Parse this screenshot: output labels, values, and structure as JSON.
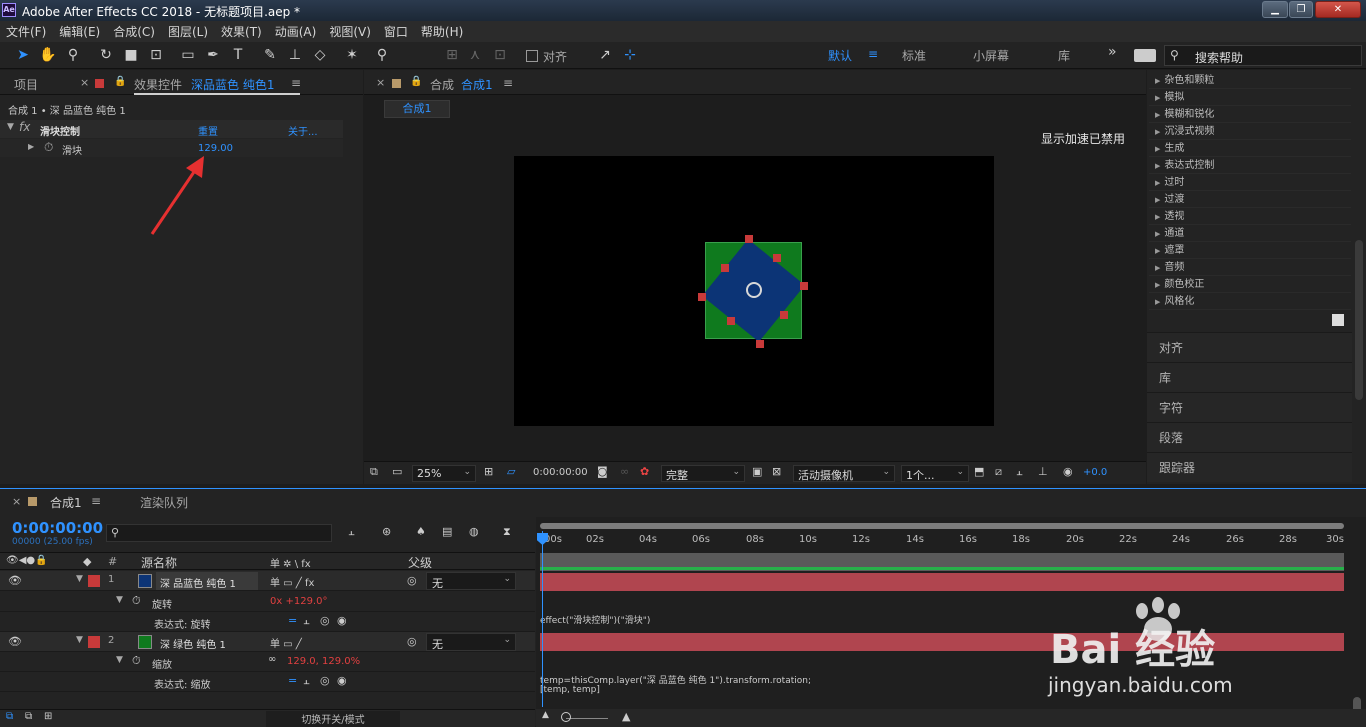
{
  "window": {
    "title": "Adobe After Effects CC 2018 - 无标题项目.aep *",
    "logo": "Ae"
  },
  "menu": [
    "文件(F)",
    "编辑(E)",
    "合成(C)",
    "图层(L)",
    "效果(T)",
    "动画(A)",
    "视图(V)",
    "窗口",
    "帮助(H)"
  ],
  "toolbar": {
    "snap_label": "对齐",
    "workspaces": [
      "默认",
      "标准",
      "小屏幕",
      "库"
    ],
    "more": "»",
    "search_placeholder": "搜索帮助"
  },
  "left_panel": {
    "tab_project": "项目",
    "tab_effects": "效果控件",
    "effects_layer": "深品蓝色 纯色1",
    "breadcrumb": "合成 1 • 深 品蓝色 纯色 1",
    "effect_name": "滑块控制",
    "reset": "重置",
    "about": "关于...",
    "param_name": "滑块",
    "param_value": "129.00"
  },
  "viewer": {
    "tab_prefix": "合成",
    "tab_name": "合成1",
    "subtab": "合成1",
    "accel_notice": "显示加速已禁用",
    "zoom": "25%",
    "timecode": "0:00:00:00",
    "quality": "完整",
    "camera": "活动摄像机",
    "views": "1个...",
    "exposure": "+0.0"
  },
  "effects_list": [
    "杂色和颗粒",
    "模拟",
    "模糊和锐化",
    "沉浸式视频",
    "生成",
    "表达式控制",
    "过时",
    "过渡",
    "透视",
    "通道",
    "遮罩",
    "音频",
    "颜色校正",
    "风格化"
  ],
  "side_sections": [
    "对齐",
    "库",
    "字符",
    "段落",
    "跟踪器"
  ],
  "timeline": {
    "tab_comp": "合成1",
    "tab_render": "渲染队列",
    "timecode": "0:00:00:00",
    "frame_info": "00000 (25.00 fps)",
    "col_num": "#",
    "col_source": "源名称",
    "col_switches": "单 ✲ \\ fx",
    "col_parent": "父级",
    "toggle_label": "切换开关/模式",
    "ruler": [
      "00s",
      "02s",
      "04s",
      "06s",
      "08s",
      "10s",
      "12s",
      "14s",
      "16s",
      "18s",
      "20s",
      "22s",
      "24s",
      "26s",
      "28s",
      "30s"
    ],
    "layers": [
      {
        "num": "1",
        "name": "深 品蓝色 纯色 1",
        "swatch": "#0c3476",
        "parent": "无",
        "prop": "旋转",
        "prop_value": "0x +129.0°",
        "expr_label": "表达式: 旋转",
        "expression": "effect(\"滑块控制\")(\"滑块\")"
      },
      {
        "num": "2",
        "name": "深 绿色 纯色 1",
        "swatch": "#0f7a1e",
        "parent": "无",
        "prop": "缩放",
        "prop_value": "129.0, 129.0%",
        "expr_label": "表达式: 缩放",
        "expression": "temp=thisComp.layer(\"深 品蓝色 纯色 1\").transform.rotation;",
        "expression2": "[temp, temp]"
      }
    ]
  },
  "watermark": {
    "brand": "Bai 经验",
    "site": "jingyan.baidu.com"
  },
  "colors": {
    "accent": "#2f92ff",
    "layer_bar": "#b0454f",
    "blue_solid": "#0c3476",
    "green_solid": "#0f7a1e",
    "handle": "#c83a3a"
  }
}
